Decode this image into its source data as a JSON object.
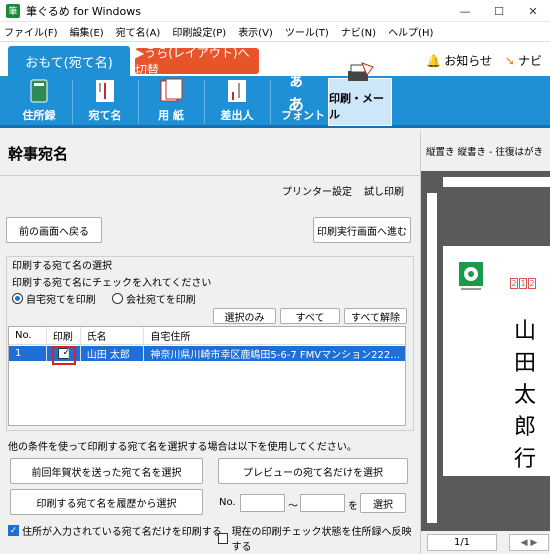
{
  "window": {
    "title": "筆ぐるめ for Windows",
    "app_icon": "fude-icon",
    "min": "—",
    "max": "☐",
    "close": "✕"
  },
  "menu": [
    "ファイル(F)",
    "編集(E)",
    "宛て名(A)",
    "印刷設定(P)",
    "表示(V)",
    "ツール(T)",
    "ナビ(N)",
    "ヘルプ(H)"
  ],
  "mode": {
    "front": "おもて(宛て名)",
    "back": "▶うら(レイアウト)へ切替",
    "notice": "お知らせ",
    "navi": "ナビ"
  },
  "toolbar": [
    {
      "label": "住所録",
      "icon": "address-book-icon"
    },
    {
      "label": "宛て名",
      "icon": "addressee-icon"
    },
    {
      "label": "用 紙",
      "icon": "paper-icon"
    },
    {
      "label": "差出人",
      "icon": "sender-icon"
    },
    {
      "label": "フォント",
      "icon": "font-icon",
      "glyph": "ぁあ"
    },
    {
      "label": "印刷・メール",
      "icon": "printer-icon",
      "active": true
    }
  ],
  "page": {
    "title": "幹事宛名",
    "link_printer": "プリンター設定",
    "link_test": "試し印刷"
  },
  "buttons": {
    "back": "前の画面へ戻る",
    "next": "印刷実行画面へ進む",
    "select_only": "選択のみ",
    "all": "すべて",
    "clear_all": "すべて解除",
    "prev_year": "前回年賀状を送った宛て名を選択",
    "preview_only": "プレビューの宛て名だけを選択",
    "history": "印刷する宛て名を履歴から選択",
    "select": "選択"
  },
  "selection": {
    "group_label": "印刷する宛て名の選択",
    "hint": "印刷する宛て名にチェックを入れてください",
    "radio_home": "自宅宛てを印刷",
    "radio_company": "会社宛てを印刷"
  },
  "table": {
    "headers": [
      "No.",
      "印刷",
      "氏名",
      "自宅住所"
    ],
    "rows": [
      {
        "no": "1",
        "checked": "✓",
        "name": "山田 太郎",
        "address": "神奈川県川崎市幸区鹿嶋田5-6-7 FMVマンション222…"
      }
    ]
  },
  "other": {
    "note": "他の条件を使って印刷する宛て名を選択する場合は以下を使用してください。",
    "no_label": "No.",
    "tilde": "〜",
    "wo": "を",
    "cb_address_only": "住所が入力されている宛て名だけを印刷する",
    "cb_reflect": "現在の印刷チェック状態を住所録へ反映する"
  },
  "preview": {
    "label": "縦置き 縦書き - 往復はがき",
    "postal": [
      "2",
      "1",
      "2"
    ],
    "name_chars": [
      "山",
      "田",
      "太",
      "郎",
      "行"
    ],
    "page_indicator": "1/1"
  }
}
